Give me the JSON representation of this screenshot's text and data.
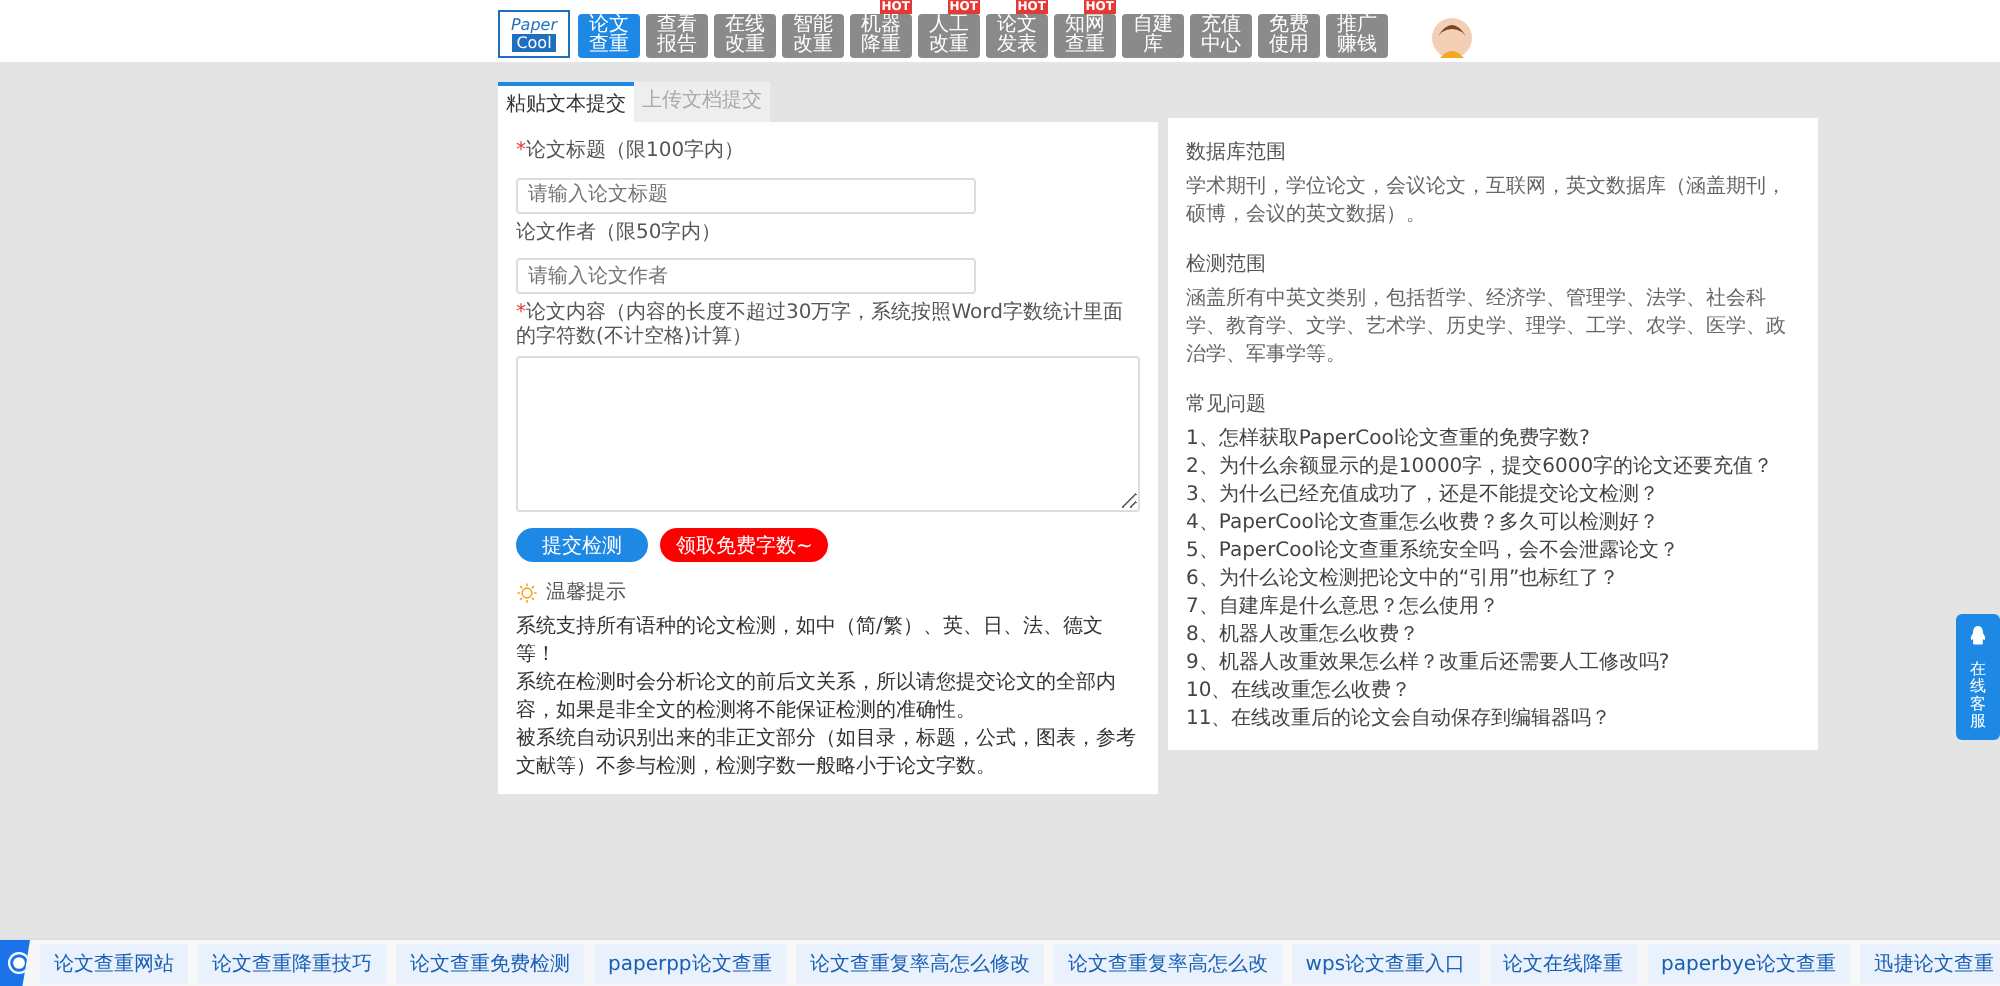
{
  "header": {
    "logo": {
      "top": "Paper",
      "bottom": "Cool"
    },
    "nav": [
      {
        "label": "论文查重",
        "selected": true
      },
      {
        "label": "查看报告",
        "selected": false
      },
      {
        "label": "在线改重",
        "selected": false
      },
      {
        "label": "智能改重",
        "selected": false
      },
      {
        "label": "机器降重",
        "selected": false,
        "badge": "HOT"
      },
      {
        "label": "人工改重",
        "selected": false,
        "badge": "HOT"
      },
      {
        "label": "论文发表",
        "selected": false,
        "badge": "HOT"
      },
      {
        "label": "知网查重",
        "selected": false,
        "badge": "HOT"
      },
      {
        "label": "自建库",
        "selected": false
      },
      {
        "label": "充值中心",
        "selected": false
      },
      {
        "label": "免费使用",
        "selected": false
      },
      {
        "label": "推广赚钱",
        "selected": false
      }
    ]
  },
  "tabs": [
    {
      "label": "粘贴文本提交",
      "selected": true
    },
    {
      "label": "上传文档提交",
      "selected": false
    }
  ],
  "form": {
    "fields": [
      {
        "label": "论文标题（限100字内）",
        "required": true,
        "placeholder": "请输入论文标题",
        "kind": "input"
      },
      {
        "label": "论文作者（限50字内）",
        "required": false,
        "placeholder": "请输入论文作者",
        "kind": "input"
      },
      {
        "label": "论文内容（内容的长度不超过30万字，系统按照Word字数统计里面的字符数(不计空格)计算）",
        "required": true,
        "kind": "textarea"
      }
    ],
    "required_mark": "*",
    "buttons": [
      {
        "label": "提交检测",
        "kind": "primary"
      },
      {
        "label": "领取免费字数~",
        "kind": "danger"
      }
    ],
    "tips_title": "温馨提示",
    "tips": [
      "系统支持所有语种的论文检测，如中（简/繁）、英、日、法、德文等！",
      "系统在检测时会分析论文的前后文关系，所以请您提交论文的全部内容，如果是非全文的检测将不能保证检测的准确性。",
      "被系统自动识别出来的非正文部分（如目录，标题，公式，图表，参考文献等）不参与检测，检测字数一般略小于论文字数。"
    ]
  },
  "info": {
    "sections": [
      {
        "title": "数据库范围",
        "text": "学术期刊，学位论文，会议论文，互联网，英文数据库（涵盖期刊，硕博，会议的英文数据）。"
      },
      {
        "title": "检测范围",
        "text": "涵盖所有中英文类别，包括哲学、经济学、管理学、法学、社会科学、教育学、文学、艺术学、历史学、理学、工学、农学、医学、政治学、军事学等。"
      }
    ],
    "faq_title": "常见问题",
    "faq": [
      "1、怎样获取PaperCool论文查重的免费字数?",
      "2、为什么余额显示的是10000字，提交6000字的论文还要充值？",
      "3、为什么已经充值成功了，还是不能提交论文检测？",
      "4、PaperCool论文查重怎么收费？多久可以检测好？",
      "5、PaperCool论文查重系统安全吗，会不会泄露论文？",
      "6、为什么论文检测把论文中的“引用”也标红了？",
      "7、自建库是什么意思？怎么使用？",
      "8、机器人改重怎么收费？",
      "9、机器人改重效果怎么样？改重后还需要人工修改吗?",
      "10、在线改重怎么收费？",
      "11、在线改重后的论文会自动保存到编辑器吗？"
    ]
  },
  "float_service": {
    "label": "在线客服"
  },
  "bottom_bar": {
    "links": [
      "论文查重网站",
      "论文查重降重技巧",
      "论文查重免费检测",
      "paperpp论文查重",
      "论文查重复率高怎么修改",
      "论文查重复率高怎么改",
      "wps论文查重入口",
      "论文在线降重",
      "paperbye论文查重",
      "迅捷论文查重"
    ]
  }
}
